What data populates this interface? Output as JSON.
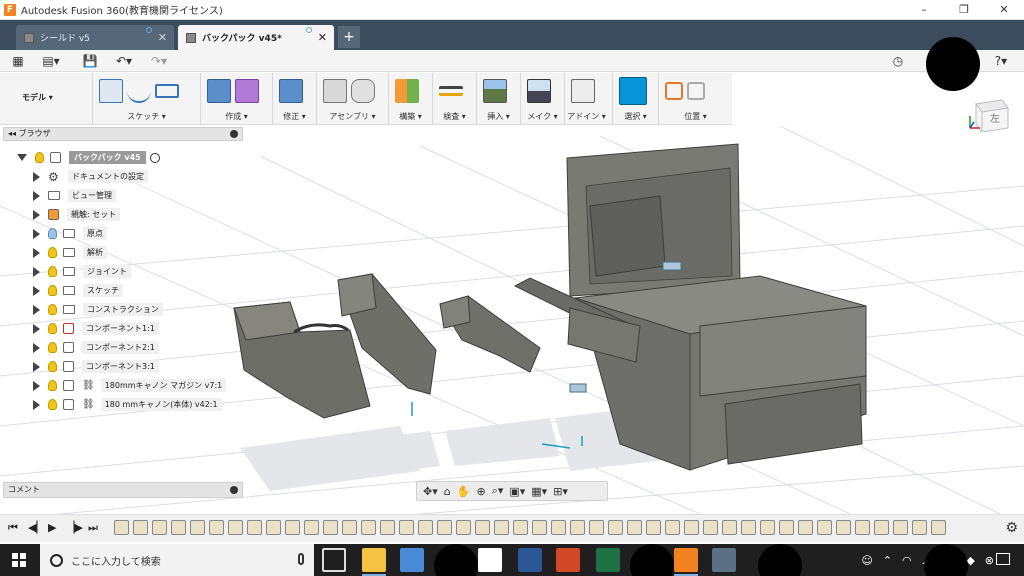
{
  "window": {
    "title": "Autodesk Fusion 360(教育機関ライセンス)"
  },
  "tabs": [
    {
      "label": "シールド v5",
      "active": false
    },
    {
      "label": "バックパック v45*",
      "active": true
    }
  ],
  "toolbar": {
    "mode": "モデル ▾",
    "groups": [
      {
        "label": "スケッチ ▾"
      },
      {
        "label": "作成 ▾"
      },
      {
        "label": "修正 ▾"
      },
      {
        "label": "アセンブリ ▾"
      },
      {
        "label": "構築 ▾"
      },
      {
        "label": "検査 ▾"
      },
      {
        "label": "挿入 ▾"
      },
      {
        "label": "メイク ▾"
      },
      {
        "label": "アドイン ▾"
      },
      {
        "label": "選択 ▾"
      },
      {
        "label": "位置 ▾"
      }
    ]
  },
  "viewcube": {
    "face_label": "左"
  },
  "browser": {
    "title": "ブラウザ",
    "root": "バックパック v45",
    "items": [
      {
        "label": "ドキュメントの設定",
        "icon": "gear-icon"
      },
      {
        "label": "ビュー管理",
        "icon": "folder-icon"
      },
      {
        "label": "親触: セット",
        "icon": "component-icon"
      },
      {
        "label": "原点",
        "icon": "folder-icon"
      },
      {
        "label": "解析",
        "icon": "folder-icon"
      },
      {
        "label": "ジョイント",
        "icon": "folder-icon"
      },
      {
        "label": "スケッチ",
        "icon": "folder-icon"
      },
      {
        "label": "コンストラクション",
        "icon": "folder-icon"
      },
      {
        "label": "コンポーネント1:1",
        "icon": "component-icon"
      },
      {
        "label": "コンポーネント2:1",
        "icon": "component-icon"
      },
      {
        "label": "コンポーネント3:1",
        "icon": "component-icon"
      },
      {
        "label": "180mmキャノン マガジン v7:1",
        "icon": "link-icon"
      },
      {
        "label": "180 mmキャノン(本体) v42:1",
        "icon": "link-icon"
      }
    ]
  },
  "comments": {
    "title": "コメント"
  },
  "taskbar": {
    "search_placeholder": "ここに入力して検索"
  },
  "colors": {
    "tab_bar": "#3c4c5c",
    "accent": "#0696d7",
    "model": "#6e6e6a"
  }
}
